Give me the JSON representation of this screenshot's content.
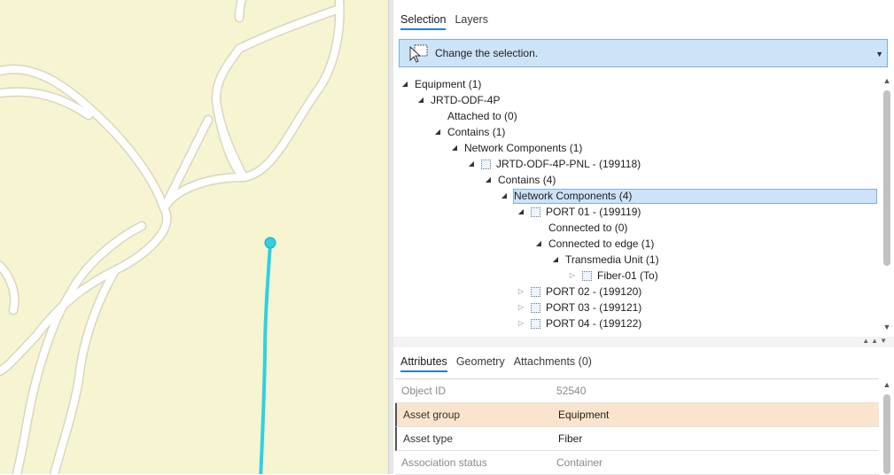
{
  "colors": {
    "map_bg": "#f7f4d2",
    "road": "#ffffff",
    "road_edge": "#d9d6be",
    "fiber_line": "#2fd1e0",
    "selection": "#cde3f7",
    "highlight_row": "#fae4ce"
  },
  "top_tabs": {
    "selection": "Selection",
    "layers": "Layers"
  },
  "change_selection": {
    "label": "Change the selection.",
    "icon": "select-cursor-icon"
  },
  "tree": {
    "equipment": "Equipment (1)",
    "jrtd": "JRTD-ODF-4P",
    "attached_to": "Attached to (0)",
    "contains1": "Contains (1)",
    "network_components1": "Network Components (1)",
    "panel": "JRTD-ODF-4P-PNL - (199118)",
    "contains4": "Contains (4)",
    "network_components4": "Network Components (4)",
    "port01": "PORT 01 - (199119)",
    "connected_to": "Connected to (0)",
    "connected_to_edge": "Connected to edge (1)",
    "transmedia": "Transmedia Unit (1)",
    "fiber01": "Fiber-01 (To)",
    "port02": "PORT 02 - (199120)",
    "port03": "PORT 03 - (199121)",
    "port04": "PORT 04 - (199122)"
  },
  "bottom_tabs": {
    "attributes": "Attributes",
    "geometry": "Geometry",
    "attachments": "Attachments (0)"
  },
  "attributes": [
    {
      "key": "Object ID",
      "value": "52540"
    },
    {
      "key": "Asset group",
      "value": "Equipment"
    },
    {
      "key": "Asset type",
      "value": "Fiber"
    },
    {
      "key": "Association status",
      "value": "Container"
    }
  ]
}
